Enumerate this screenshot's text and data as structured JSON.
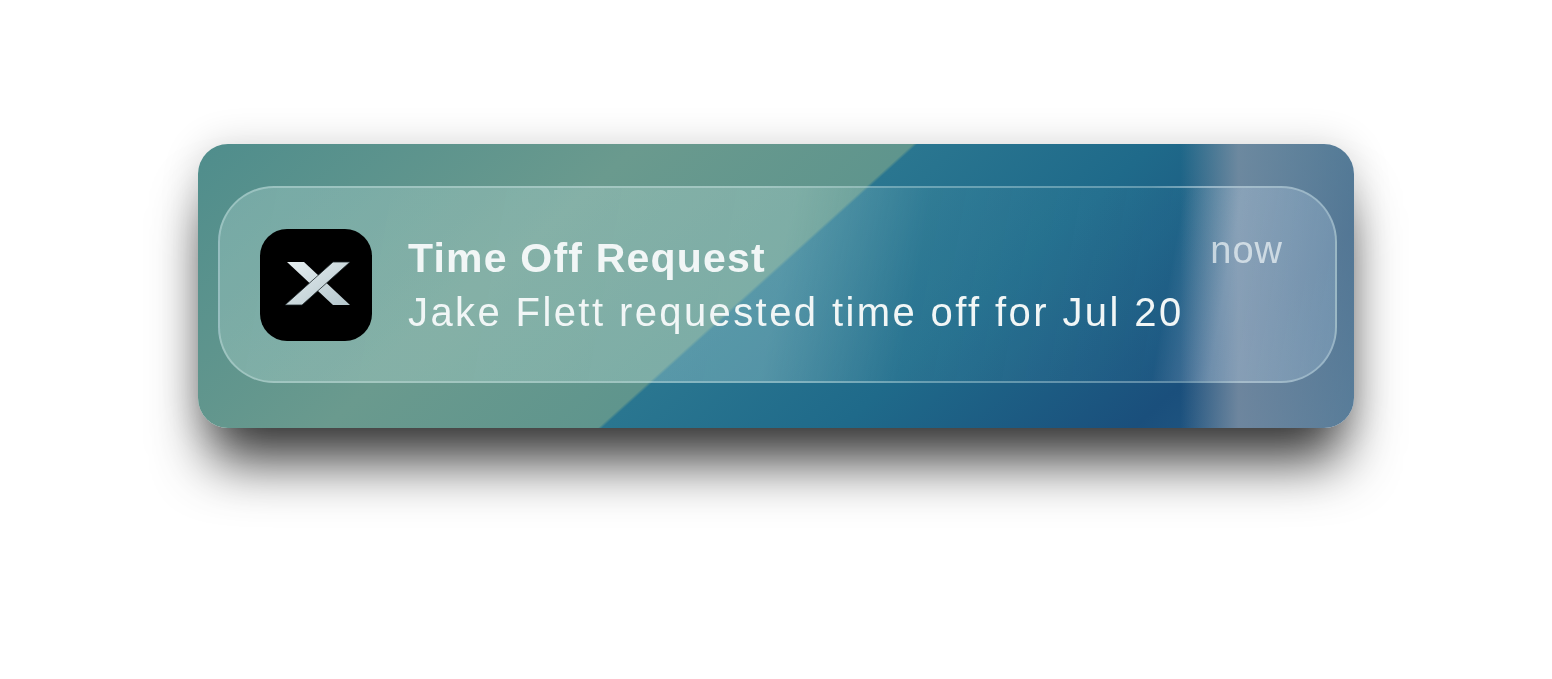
{
  "notification": {
    "title": "Time Off Request",
    "body": "Jake Flett requested time off for Jul 20",
    "time": "now"
  }
}
